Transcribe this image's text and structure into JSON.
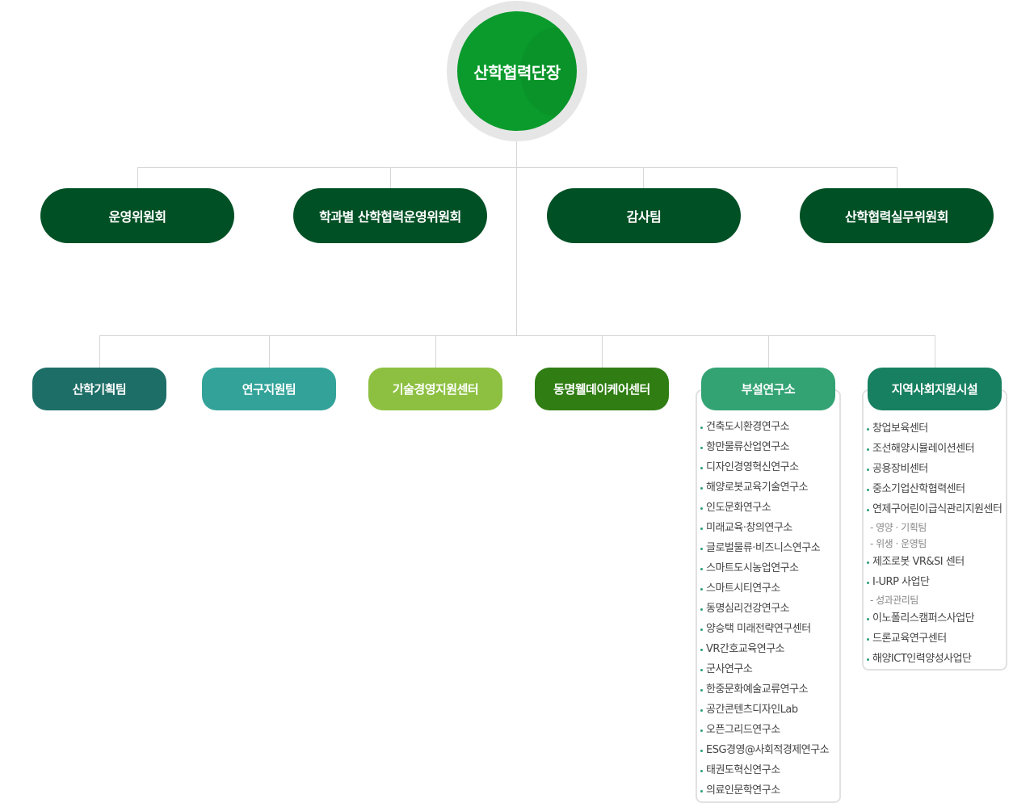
{
  "head": {
    "label": "산학협력단장"
  },
  "level1": [
    {
      "label": "운영위원회"
    },
    {
      "label": "학과별 산학협력운영위원회"
    },
    {
      "label": "감사팀"
    },
    {
      "label": "산학협력실무위원회"
    }
  ],
  "level2": [
    {
      "label": "산학기획팀",
      "color": "#1e6e68"
    },
    {
      "label": "연구지원팀",
      "color": "#33a39a"
    },
    {
      "label": "기술경영지원센터",
      "color": "#8dc041"
    },
    {
      "label": "동명웰데이케어센터",
      "color": "#2f7d13"
    },
    {
      "label": "부설연구소",
      "color": "#33a374"
    },
    {
      "label": "지역사회지원시설",
      "color": "#178060"
    }
  ],
  "institutes": [
    "건축도시환경연구소",
    "항만물류산업연구소",
    "디자인경영혁신연구소",
    "해양로봇교육기술연구소",
    "인도문화연구소",
    "미래교육·창의연구소",
    "글로벌물류·비즈니스연구소",
    "스마트도시농업연구소",
    "스마트시티연구소",
    "동명심리건강연구소",
    "양승택 미래전략연구센터",
    "VR간호교육연구소",
    "군사연구소",
    "한중문화예술교류연구소",
    "공간콘텐츠디자인Lab",
    "오픈그리드연구소",
    "ESG경영@사회적경제연구소",
    "태권도혁신연구소",
    "의료인문학연구소"
  ],
  "facilities": [
    {
      "label": "창업보육센터",
      "subs": []
    },
    {
      "label": "조선해양시뮬레이션센터",
      "subs": []
    },
    {
      "label": "공용장비센터",
      "subs": []
    },
    {
      "label": "중소기업산학협력센터",
      "subs": []
    },
    {
      "label": "연제구어린이급식관리지원센터",
      "subs": [
        "- 영양 · 기획팀",
        "- 위생 · 운영팀"
      ]
    },
    {
      "label": "제조로봇 VR&SI 센터",
      "subs": []
    },
    {
      "label": "I-URP 사업단",
      "subs": [
        "- 성과관리팀"
      ]
    },
    {
      "label": "이노폴리스캠퍼스사업단",
      "subs": []
    },
    {
      "label": "드론교육연구센터",
      "subs": []
    },
    {
      "label": "해양ICT인력양성사업단",
      "subs": []
    }
  ]
}
